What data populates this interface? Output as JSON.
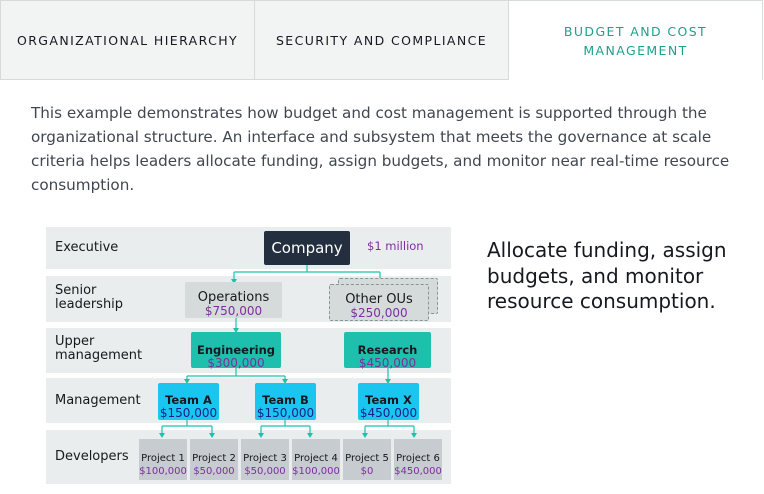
{
  "tabs": [
    {
      "label": "ORGANIZATIONAL HIERARCHY",
      "active": false
    },
    {
      "label": "SECURITY AND COMPLIANCE",
      "active": false
    },
    {
      "label": "BUDGET AND COST MANAGEMENT",
      "active": true
    }
  ],
  "colors": {
    "active_tab": "#1da08f",
    "budget_text": "#7d2ea0",
    "company_box": "#232f3e",
    "teal_box": "#1ec0ad",
    "cyan_box": "#1ac6f0",
    "row_band": "#eaeded"
  },
  "intro": "This example demonstrates how budget and cost management is supported through the organizational structure. An interface and subsystem that meets the governance at scale criteria helps leaders allocate funding, assign budgets, and monitor near real-time resource consumption.",
  "diagram": {
    "rows": [
      {
        "label": "Executive"
      },
      {
        "label": "Senior leadership"
      },
      {
        "label": "Upper management"
      },
      {
        "label": "Management"
      },
      {
        "label": "Developers"
      }
    ],
    "company": {
      "name": "Company",
      "budget": "$1 million"
    },
    "senior": [
      {
        "name": "Operations",
        "budget": "$750,000"
      },
      {
        "name": "Other OUs",
        "budget": "$250,000"
      }
    ],
    "upper": [
      {
        "name": "Engineering",
        "budget": "$300,000"
      },
      {
        "name": "Research",
        "budget": "$450,000"
      }
    ],
    "management": [
      {
        "name": "Team A",
        "budget": "$150,000"
      },
      {
        "name": "Team B",
        "budget": "$150,000"
      },
      {
        "name": "Team X",
        "budget": "$450,000"
      }
    ],
    "projects": [
      {
        "name": "Project 1",
        "budget": "$100,000"
      },
      {
        "name": "Project 2",
        "budget": "$50,000"
      },
      {
        "name": "Project 3",
        "budget": "$50,000"
      },
      {
        "name": "Project 4",
        "budget": "$100,000"
      },
      {
        "name": "Project 5",
        "budget": "$0"
      },
      {
        "name": "Project 6",
        "budget": "$450,000"
      }
    ]
  },
  "callout": "Allocate funding, assign budgets, and monitor resource consumption."
}
